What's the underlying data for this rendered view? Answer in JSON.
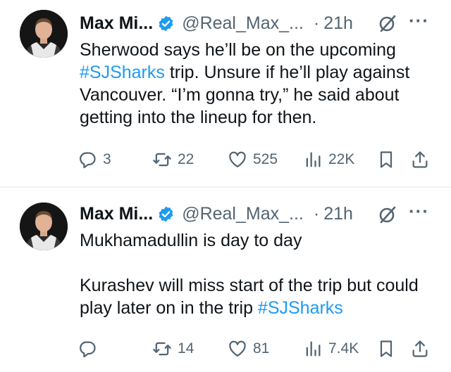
{
  "tweets": [
    {
      "author_name": "Max Mi...",
      "author_handle": "@Real_Max_...",
      "dot": "·",
      "time": "21h",
      "more_label": "···",
      "text_parts": [
        "Sherwood says he’ll be on the upcoming ",
        "#SJSharks",
        " trip. Unsure if he’ll play against Vancouver. “I’m gonna try,” he said about getting into the lineup for then."
      ],
      "replies": "3",
      "reposts": "22",
      "likes": "525",
      "views": "22K"
    },
    {
      "author_name": "Max Mi...",
      "author_handle": "@Real_Max_...",
      "dot": "·",
      "time": "21h",
      "more_label": "···",
      "paragraph1": "Mukhamadullin is day to day",
      "paragraph2_parts": [
        "Kurashev will miss start of the trip but could play later on in the trip ",
        "#SJSharks"
      ],
      "replies": "",
      "reposts": "14",
      "likes": "81",
      "views": "7.4K"
    }
  ],
  "colors": {
    "text": "#0f1419",
    "secondary": "#536471",
    "hashtag": "#1d9bf0",
    "verified_badge": "#1d9bf0",
    "divider": "#eff3f4"
  },
  "icons": {
    "reply": "reply-icon",
    "repost": "repost-icon",
    "like": "heart-icon",
    "views": "views-icon",
    "bookmark": "bookmark-icon",
    "share": "share-icon",
    "verified": "verified-badge-icon",
    "grok": "grok-icon",
    "more": "more-icon"
  }
}
